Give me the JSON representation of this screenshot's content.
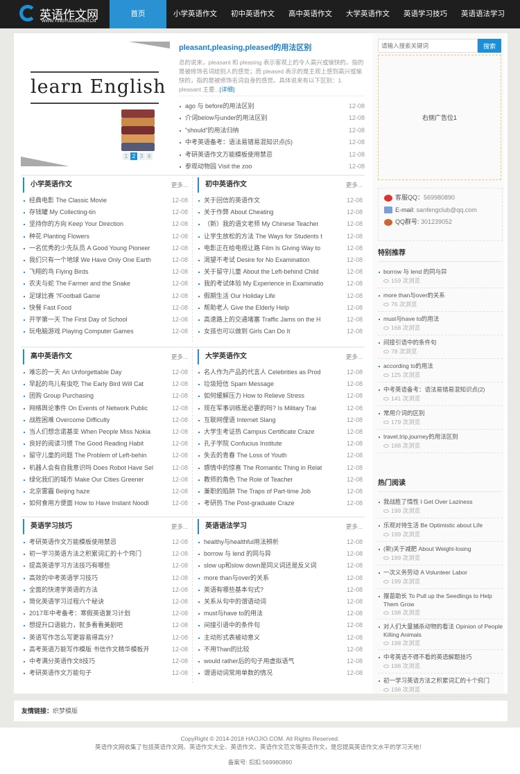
{
  "header": {
    "logo_title": "英语作文网",
    "logo_sub": "WWW.YINGYUZUOWEN.CN",
    "nav": [
      "首页",
      "小学英语作文",
      "初中英语作文",
      "高中英语作文",
      "大学英语作文",
      "英语学习技巧",
      "英语语法学习"
    ],
    "brand_color": "#2a92d3"
  },
  "slider": {
    "image_text": "learn English",
    "pages": [
      "1",
      "2",
      "3",
      "4"
    ],
    "active_page": 2
  },
  "headline": {
    "title": "pleasant,pleasing,pleased的用法区别",
    "summary": "总的说来，pleasant 和 pleasing 表示客观上的令人高兴或愉快的，指的是被修饰名词给别人的感觉；而 pleased 表示的是主观上感到高兴或愉快的，指的是被修饰名词自身的感觉。具体说来有以下区别：1. pleasant 主要...",
    "more": "[详细]"
  },
  "top_list": [
    [
      "ago 与 before的用法区别",
      "12-08"
    ],
    [
      "介词below与under的用法区别",
      "12-08"
    ],
    [
      "“should”的用法归纳",
      "12-08"
    ],
    [
      "中考英语备考：语法易错易混知识点(5)",
      "12-08"
    ],
    [
      "考研英语作文万能模板使用禁忌",
      "12-08"
    ],
    [
      "参观动物园 Visit the zoo",
      "12-08"
    ]
  ],
  "sections": [
    {
      "title": "小学英语作文",
      "more": "更多...",
      "items": [
        "经典电影 The Classic Movie",
        "存钱罐 My Collecting-tin",
        "坚持你的方向 Keep Your Direction",
        "种花 Planting Flowers",
        "一名优秀的少先队员 A Good Young Pioneer",
        "我们只有一个地球 We Have Only One Earth",
        "飞翔的鸟 Flying Birds",
        "农夫与蛇 The Farmer and the Snake",
        "足球比赛 ?Football Game",
        "快餐 Fast Food",
        "开学第一天 The First Day of School",
        "玩电脑游戏 Playing Computer Games"
      ]
    },
    {
      "title": "初中英语作文",
      "more": "更多...",
      "items": [
        "关于回信的英语作文",
        "关于作弊 About Cheating",
        "（新）我的语文老师 My Chinese Teacher",
        "让学生放松的方法 The Ways for Students t",
        "电影正在给电视让路 Film Is Giving Way to",
        "渴望不考试 Desire for No Examination",
        "关于留守儿童 About the Left-behind Child",
        "我的考试体验 My Experience in Examinatio",
        "假期生活 Our Holiday Life",
        "帮助老人 Give the Elderly Help",
        "高速路上的交通堵塞 Traffic Jams on the H",
        "女孩也可以做到 Girls Can Do It"
      ]
    },
    {
      "title": "高中英语作文",
      "more": "更多...",
      "items": [
        "难忘的一天 An Unforgettable Day",
        "早起的鸟儿有虫吃 The Early Bird Will Cat",
        "团购 Group Purchasing",
        "网络舆论事件 On Events of Network Public",
        "战胜困难 Overcome Difficulty",
        "当人们想念诺基亚 When People Miss Nokia",
        "良好的阅读习惯 The Good Reading Habit",
        "留守儿童的问题 The Problem of Left-behin",
        "机器人会有自我意识吗 Does Robot Have Sel",
        "绿化我们的城市 Make Our Cities Greener",
        "北京雾霾 Beijing haze",
        "如何食用方便面 How to Have Instant Noodl"
      ]
    },
    {
      "title": "大学英语作文",
      "more": "更多...",
      "items": [
        "名人作为产品的代言人 Celebrities as Prod",
        "垃圾短信 Spam Message",
        "如何缓解压力 How to Relieve Stress",
        "现在军事训练是必要的吗? Is Military Trai",
        "互联网俚语 Internet Slang",
        "大学生考证热 Campus Certificate Craze",
        "孔子学院 Confucius Institute",
        "失去的青春 The Loss of Youth",
        "感情中的惊喜 The Romantic Thing in Relat",
        "教师的角色 The Role of Teacher",
        "兼职的陷阱 The Traps of Part-time Job",
        "考研热 The Post-graduate Craze"
      ]
    },
    {
      "title": "英语学习技巧",
      "more": "更多...",
      "items": [
        "考研英语作文万能模板使用禁忌",
        "初一学习英语方法之积累词汇的十个窍门",
        "提高英语学习方法技巧有哪些",
        "高效的中考英语学习技巧",
        "全面的快速学英语的方法",
        "简化英语学习过程六个秘诀",
        "2017年中考备考：寒假英语复习计划",
        "想提升口语能力，就多看看美剧吧",
        "英语写作怎么写更容易得高分？",
        "高考英语万能写作模版 书信作文精华模板开",
        "中考满分英语作文8技巧",
        "考研英语作文万能句子"
      ]
    },
    {
      "title": "英语语法学习",
      "more": "更多...",
      "items": [
        "healthy与healthful用法辨析",
        "borrow 与 lend 的同与异",
        "slow up和slow down是同义词还是反义词",
        "more than与over的关系",
        "英语有哪些基本句式?",
        "关系从句中的谓语动词",
        "must与have to的用法",
        "间接引语中的条件句",
        "主动形式表被动意义",
        "不用Than的比较",
        "would rather后的句子用虚拟语气",
        "谓语动词常用单数的情况"
      ]
    }
  ],
  "date": "12-08",
  "sidebar": {
    "search_placeholder": "请输入搜索关键词",
    "search_button": "搜索",
    "ad_text": "右侧广告位1",
    "contact": [
      [
        "客服QQ：",
        "569980890"
      ],
      [
        "E-mail: ",
        "sanfengclub@qq.com"
      ],
      [
        "QQ群号: ",
        "301239052"
      ]
    ],
    "views_suffix": " 次浏览",
    "recommend_title": "特别推荐",
    "recommend": [
      [
        "borrow 与 lend 的同与异",
        "159"
      ],
      [
        "more than与over的关系",
        "76"
      ],
      [
        "must与have to的用法",
        "168"
      ],
      [
        "间接引语中的条件句",
        "78"
      ],
      [
        "according to的用法",
        "125"
      ],
      [
        "中考英语备考：语法易错易混知识点(2)",
        "141"
      ],
      [
        "常用介词的区别",
        "179"
      ],
      [
        "travel,trip,journey的用法区别",
        "188"
      ]
    ],
    "hot_title": "热门阅读",
    "hot": [
      [
        "我战胜了惰性 I Get Over Laziness",
        "199"
      ],
      [
        "乐观对待生活 Be Optimistic about Life",
        "199"
      ],
      [
        "(新)关于减肥 About Weight-losing",
        "199"
      ],
      [
        "一次义务劳动 A Volunteer Labor",
        "199"
      ],
      [
        "揠苗助长 To Pull up the Seedlings to Help Them Grow",
        "198"
      ],
      [
        "对人们大量捕杀动物的看法 Opinion of People Killing Animals",
        "198"
      ],
      [
        "中考英语不得不看的英语解题技巧",
        "198"
      ],
      [
        "初一学习英语方法之积累词汇的十个窍门",
        "198"
      ]
    ]
  },
  "links": {
    "label": "友情链接：",
    "items": [
      "织梦模版"
    ]
  },
  "footer": {
    "copyright": "CopyRight © 2014-2018 HAOJIO.COM. All Rights Reserved.",
    "desc": "英语作文网收集了包括英语作文网、英语作文大全、英语作文、英语作文范文等英语作文，是您提高英语作文水平的学习天地！",
    "icp": "备案号:  扣扣:569980890"
  }
}
